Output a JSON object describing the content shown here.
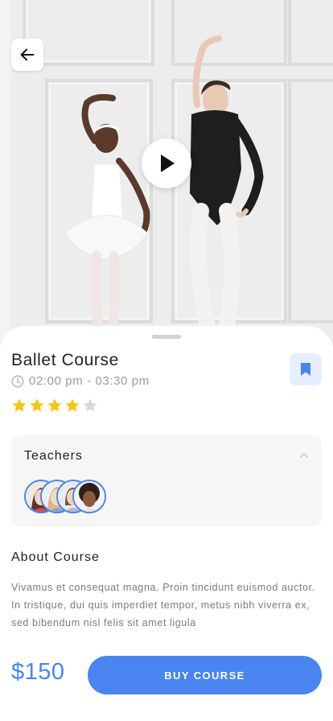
{
  "hero": {
    "back_icon": "arrow-left-icon",
    "play_icon": "play-icon"
  },
  "course": {
    "title": "Ballet Course",
    "time": "02:00 pm - 03:30 pm",
    "rating": 4,
    "rating_max": 5,
    "bookmark_icon": "bookmark-icon"
  },
  "teachers": {
    "title": "Teachers",
    "count": 4
  },
  "about": {
    "title": "About Course",
    "text": "Vivamus et consequat magna. Proin tincidunt euismod auctor. In tristique, dui quis imperdiet tempor, metus nibh viverra ex, sed bibendum nisl felis sit amet ligula"
  },
  "footer": {
    "price": "$150",
    "buy_label": "BUY COURSE"
  },
  "colors": {
    "accent": "#4a84f0",
    "star_filled": "#f5c518",
    "star_empty": "#d9d9d9",
    "bookmark_bg": "#e6efff"
  }
}
